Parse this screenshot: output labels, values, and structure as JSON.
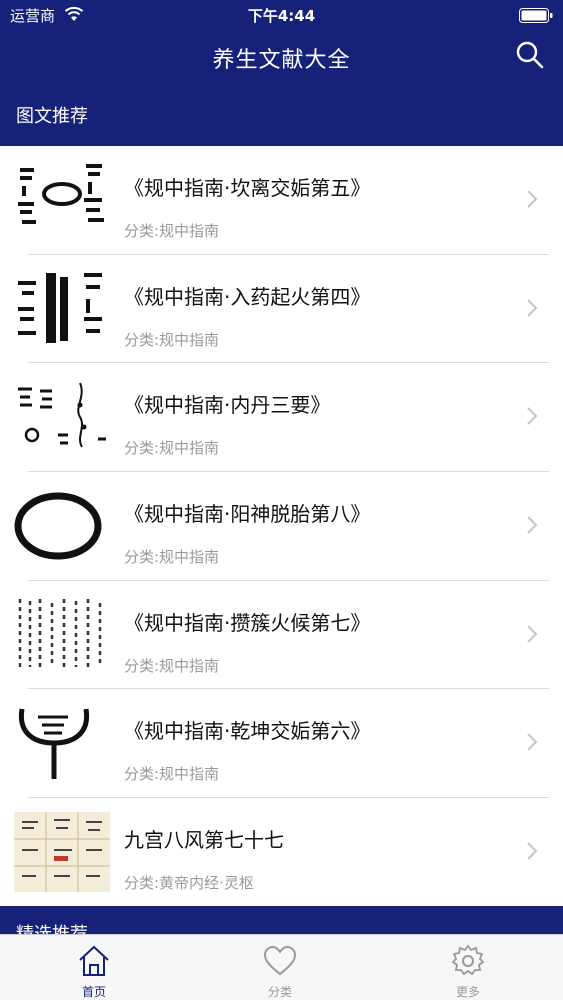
{
  "status_bar": {
    "carrier": "运营商",
    "time": "下午4:44"
  },
  "nav": {
    "title": "养生文献大全",
    "search_icon": "search-icon"
  },
  "sections": {
    "recommended": "图文推荐",
    "featured": "精选推荐"
  },
  "articles": [
    {
      "title": "《规中指南·坎离交姤第五》",
      "category": "分类:规中指南"
    },
    {
      "title": "《规中指南·入药起火第四》",
      "category": "分类:规中指南"
    },
    {
      "title": "《规中指南·内丹三要》",
      "category": "分类:规中指南"
    },
    {
      "title": "《规中指南·阳神脱胎第八》",
      "category": "分类:规中指南"
    },
    {
      "title": "《规中指南·攒簇火候第七》",
      "category": "分类:规中指南"
    },
    {
      "title": "《规中指南·乾坤交姤第六》",
      "category": "分类:规中指南"
    },
    {
      "title": "九宫八风第七十七",
      "category": "分类:黄帝内经·灵枢"
    }
  ],
  "tabs": [
    {
      "label": "首页",
      "icon": "home-icon",
      "active": true
    },
    {
      "label": "分类",
      "icon": "heart-icon",
      "active": false
    },
    {
      "label": "更多",
      "icon": "gear-icon",
      "active": false
    }
  ],
  "colors": {
    "nav_bg": "#16227a",
    "active_tab": "#16227a",
    "category_text": "#9a9a9a"
  }
}
